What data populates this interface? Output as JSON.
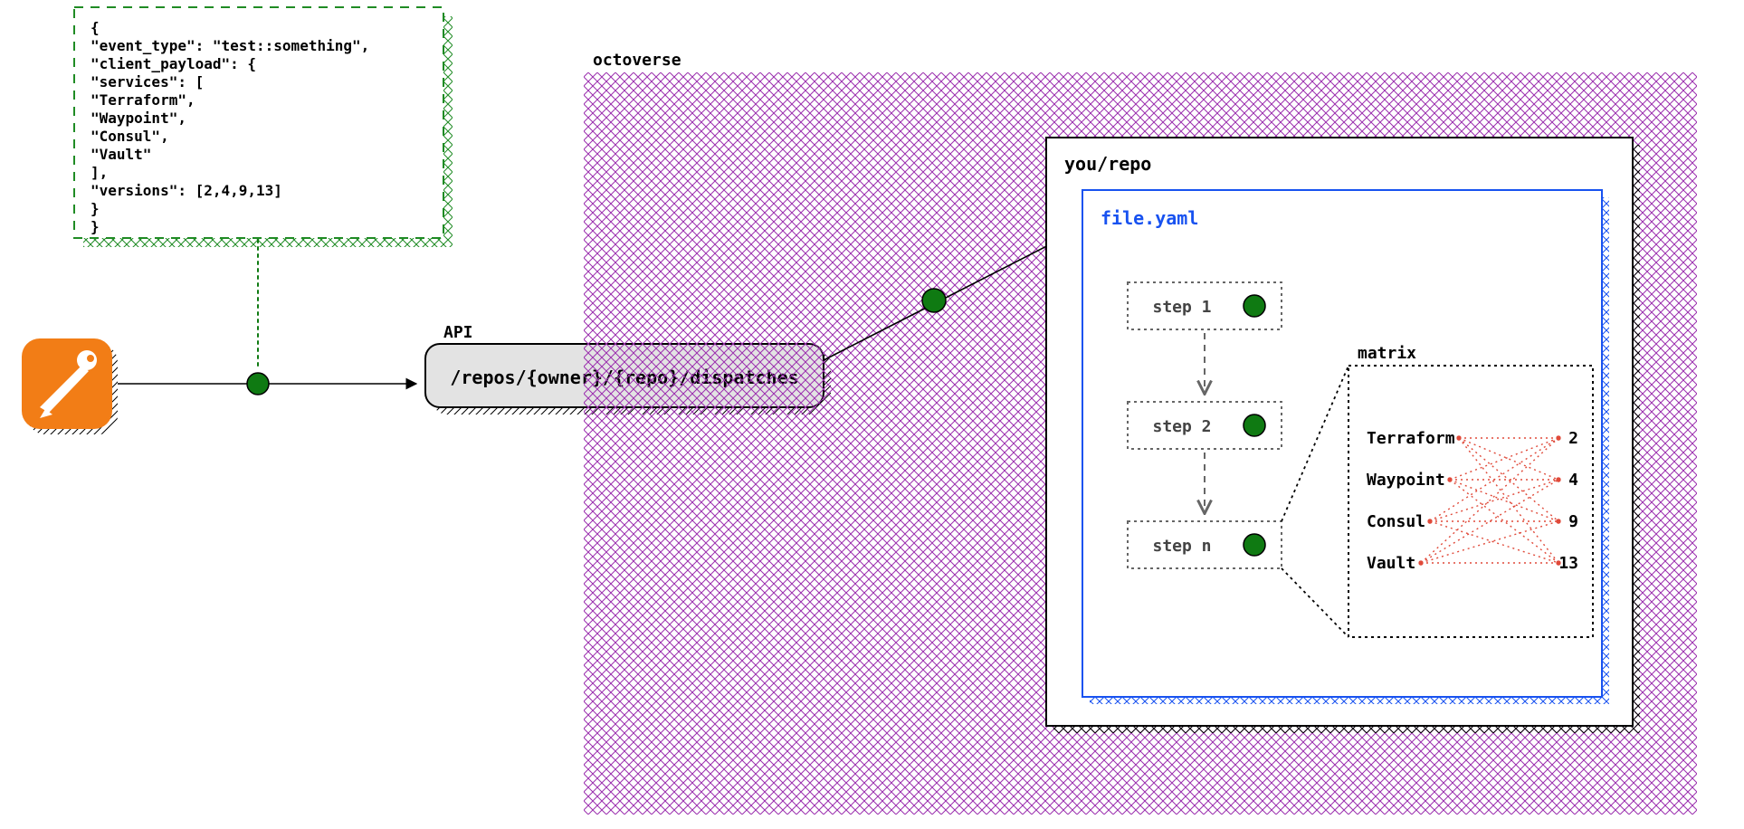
{
  "payload_json_lines": [
    "{",
    "    \"event_type\": \"test::something\",",
    "    \"client_payload\": {",
    "        \"services\": [",
    "            \"Terraform\",",
    "            \"Waypoint\",",
    "            \"Consul\",",
    "            \"Vault\"",
    "        ],",
    "        \"versions\": [2,4,9,13]",
    "    }",
    "}"
  ],
  "api": {
    "label": "API",
    "path": "/repos/{owner}/{repo}/dispatches"
  },
  "octoverse_label": "octoverse",
  "repo": {
    "label": "you/repo",
    "file_label": "file.yaml",
    "steps": [
      "step 1",
      "step 2",
      "step n"
    ]
  },
  "matrix": {
    "label": "matrix",
    "services": [
      "Terraform",
      "Waypoint",
      "Consul",
      "Vault"
    ],
    "versions": [
      "2",
      "4",
      "9",
      "13"
    ]
  },
  "colors": {
    "purple": "#9b2fae",
    "green_dash": "#1f8b24",
    "green_dot": "#0f7a12",
    "blue": "#1852f0",
    "orange": "#f27d16",
    "grey_box": "#e3e3e3",
    "grey_dash": "#666666",
    "red_dot": "#e04a3a"
  }
}
